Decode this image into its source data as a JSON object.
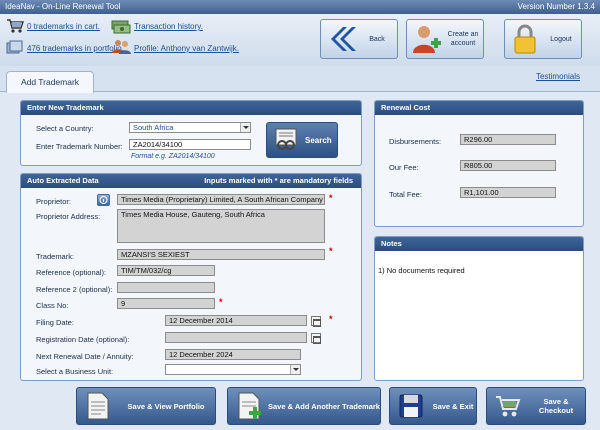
{
  "app": {
    "title": "IdeaNav - On-Line Renewal Tool",
    "version": "Version Number 1.3.4"
  },
  "header": {
    "cart_link": "0 trademarks in cart.",
    "portfolio_link": "476 trademarks in portfolio.",
    "history_link": "Transaction history.",
    "profile_link": "Profile: Anthony van Zantwijk.",
    "buttons": {
      "back": "Back",
      "create_account": "Create an account",
      "logout": "Logout"
    }
  },
  "tabs": {
    "active": "Add Trademark",
    "testimonials": "Testimonials"
  },
  "new_trademark": {
    "title": "Enter New Trademark",
    "country_label": "Select a Country:",
    "country_value": "South Africa",
    "number_label": "Enter Trademark Number:",
    "number_value": "ZA2014/34100",
    "format_hint": "Format e.g. ZA2014/34100",
    "search_label": "Search"
  },
  "auto_data": {
    "title": "Auto Extracted Data",
    "mandatory_note": "Inputs marked with * are mandatory fields",
    "proprietor_label": "Proprietor:",
    "proprietor_value": "Times Media (Proprietary) Limited, A South African Company",
    "address_label": "Proprietor Address:",
    "address_value": "Times Media House, Gauteng, South Africa",
    "trademark_label": "Trademark:",
    "trademark_value": "MZANSI'S SEXIEST",
    "ref_label": "Reference (optional):",
    "ref_value": "TIM/TM/032/cg",
    "ref2_label": "Reference 2 (optional):",
    "ref2_value": "",
    "class_label": "Class No:",
    "class_value": "9",
    "filing_label": "Filing Date:",
    "filing_value": "12 December 2014",
    "registration_label": "Registration Date (optional):",
    "registration_value": "",
    "renewal_label": "Next Renewal Date / Annuity:",
    "renewal_value": "12 December 2024",
    "business_label": "Select a Business Unit:",
    "business_value": "",
    "star": "*"
  },
  "renewal_cost": {
    "title": "Renewal Cost",
    "disbursements_label": "Disbursements:",
    "disbursements_value": "R296.00",
    "fee_label": "Our Fee:",
    "fee_value": "R805.00",
    "total_label": "Total Fee:",
    "total_value": "R1,101.00"
  },
  "notes": {
    "title": "Notes",
    "text": "1) No documents required"
  },
  "footer": {
    "save_view": "Save & View Portfolio",
    "save_add": "Save & Add Another Trademark",
    "save_exit": "Save & Exit",
    "save_checkout": "Save & Checkout"
  },
  "colors": {
    "panel_header": "#2b4c7d",
    "accent": "#1d4f93",
    "mandatory": "#d30000"
  }
}
